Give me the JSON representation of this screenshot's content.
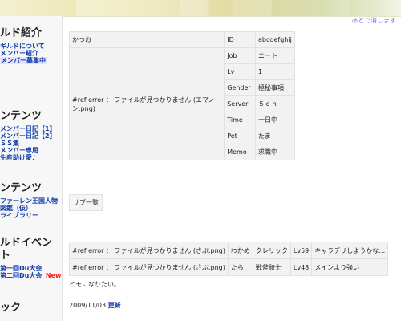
{
  "top_right_link": "あとで消します",
  "sidebar": {
    "sections": [
      {
        "title": "ルド紹介",
        "items": [
          {
            "label": "ギルドについて",
            "highlight": false
          },
          {
            "label": "メンバー紹介",
            "highlight": false
          },
          {
            "label": "",
            "highlight": false
          },
          {
            "label": "メンバー募集中",
            "highlight": true
          }
        ]
      },
      {
        "title": "ンテンツ",
        "items": [
          {
            "label": "メンバー日記【1】",
            "highlight": false
          },
          {
            "label": "メンバー日記【2】",
            "highlight": false
          },
          {
            "label": "ＳＳ集",
            "highlight": false
          },
          {
            "label": "メンバー専用",
            "highlight": false
          },
          {
            "label": "生産助け愛♪",
            "highlight": false
          }
        ]
      },
      {
        "title": "ンテンツ",
        "items": [
          {
            "label": "ファーレン王国人物",
            "highlight": false
          },
          {
            "label": "図鑑（仮）",
            "highlight": false
          },
          {
            "label": "ライブラリー",
            "highlight": false
          }
        ]
      },
      {
        "title": "ルドイベント",
        "items": [
          {
            "label": "第一回Du大会",
            "highlight": false
          },
          {
            "label": "第二回Du大会",
            "highlight": false,
            "badge": "New"
          }
        ]
      },
      {
        "title": "ック",
        "items": []
      }
    ]
  },
  "profile": {
    "name": "かつお",
    "avatar_error": "#ref error ： ファイルが見つかりません (エマノン.png)",
    "fields": [
      {
        "key": "ID",
        "value": "abcdefghij"
      },
      {
        "key": "Job",
        "value": "ニート"
      },
      {
        "key": "Lv",
        "value": "1"
      },
      {
        "key": "Gender",
        "value": "極秘事項"
      },
      {
        "key": "Server",
        "value": "５ｃｈ"
      },
      {
        "key": "Time",
        "value": "一日中"
      },
      {
        "key": "Pet",
        "value": "たま"
      },
      {
        "key": "Memo",
        "value": "求職中"
      }
    ]
  },
  "sub_tab": "サブ一覧",
  "subs": {
    "rows": [
      {
        "image_error": "#ref error ： ファイルが見つかりません (さぶ.png)",
        "name": "わかめ",
        "job": "クレリック",
        "lv": "Lv59",
        "memo": "キャラデリしようかな…"
      },
      {
        "image_error": "#ref error ： ファイルが見つかりません (さぶ.png)",
        "name": "たら",
        "job": "戦斧騎士",
        "lv": "Lv48",
        "memo": "メインより強い"
      }
    ]
  },
  "quote": "ヒモになりたい。",
  "updated": {
    "date": "2009/11/03",
    "label": "更新"
  }
}
